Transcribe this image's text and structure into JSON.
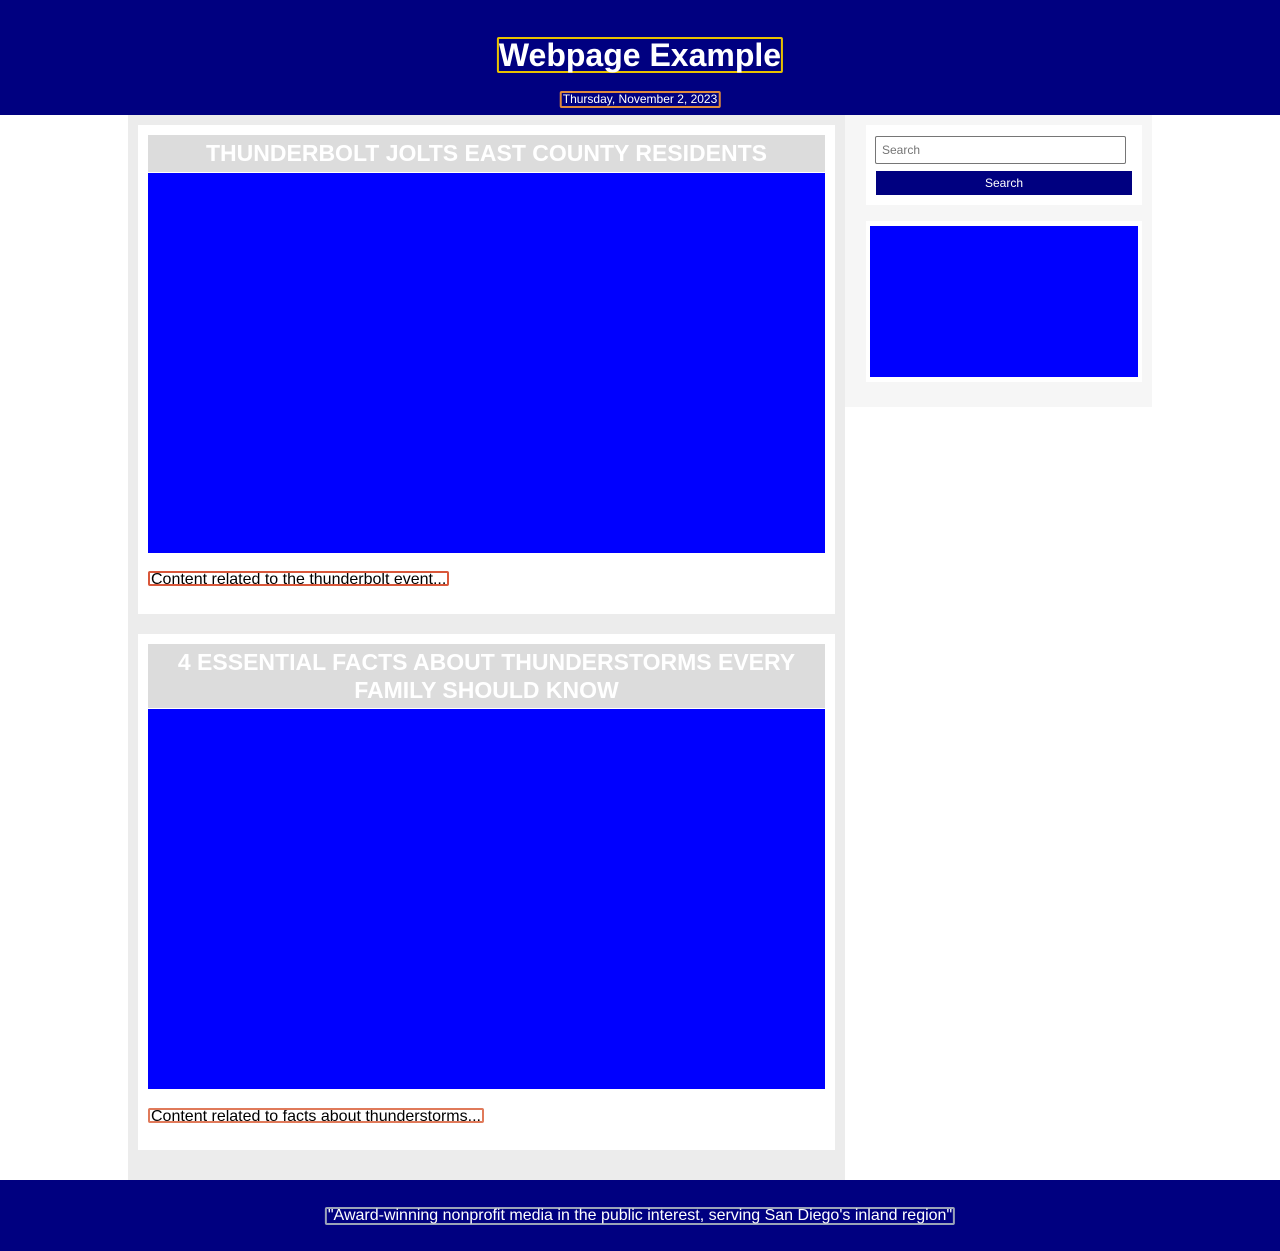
{
  "header": {
    "title": "Webpage Example",
    "date": "Thursday, November 2, 2023"
  },
  "articles": [
    {
      "headline": "THUNDERBOLT JOLTS EAST COUNTY RESIDENTS",
      "text": "Content related to the thunderbolt event..."
    },
    {
      "headline": "4 ESSENTIAL FACTS ABOUT THUNDERSTORMS EVERY FAMILY SHOULD KNOW",
      "text": "Content related to facts about thunderstorms..."
    }
  ],
  "sidebar": {
    "search": {
      "placeholder": "Search",
      "button_label": "Search"
    }
  },
  "footer": {
    "tagline": "\"Award-winning nonprofit media in the public interest, serving San Diego's inland region\""
  },
  "colors": {
    "header_bg": "#000080",
    "image_placeholder": "#0000ff",
    "headline_bg": "#dcdcdc"
  }
}
